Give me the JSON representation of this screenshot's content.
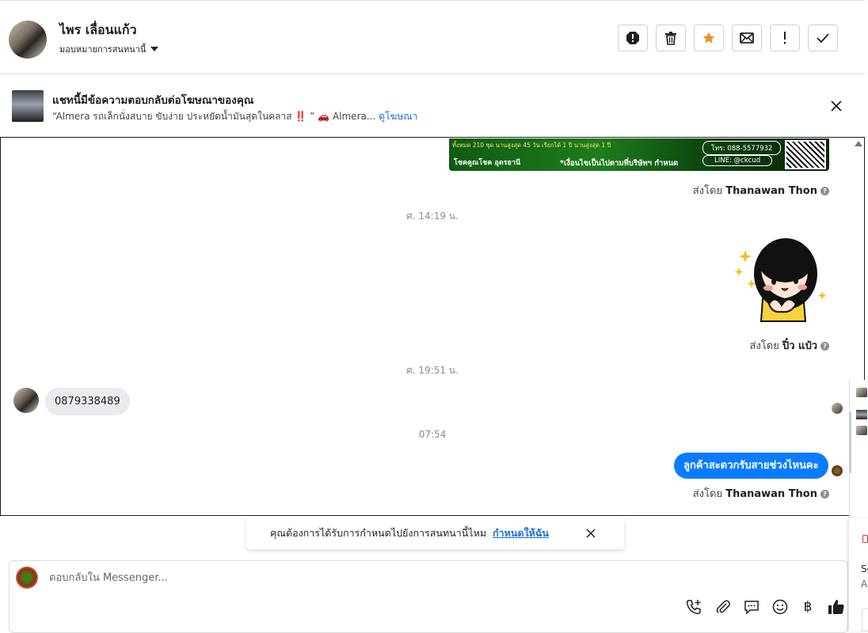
{
  "header": {
    "name": "ไพร เลื่อนแก้ว",
    "assign_label": "มอบหมายการสนทนานี้",
    "actions": [
      "report-icon",
      "trash-icon",
      "star-icon",
      "mail-icon",
      "exclamation-icon",
      "check-icon"
    ]
  },
  "ad": {
    "title": "แชทนี้มีข้อความตอบกลับต่อโฆษณาของคุณ",
    "desc": "“Almera รถเล็กนั่งสบาย ขับง่าย ประหยัดน้ำมันสุดในคลาส ‼️ ” 🚗 Almera...",
    "link": "ดูโฆษณา"
  },
  "banner": {
    "line1": "ทั้งหมด 210 ชุด   นานสูงสุด 45 วัน   เรียกได้ 1 ปี   นานสูงสุด 1 ปี",
    "brand": "โชคคูณโชค อุดรธานี",
    "tagline": "*เงื่อนไขเป็นไปตามที่บริษัทฯ กำหนด",
    "phone": "โทร: 088-5577932",
    "line_id": "LINE: @ckcud"
  },
  "messages": {
    "sent_by_1_prefix": "ส่งโดย",
    "sent_by_1_name": "Thanawan Thon",
    "ts_1": "ศ. 14:19 น.",
    "sent_by_2_prefix": "ส่งโดย",
    "sent_by_2_name": "ปิ๋ว แป๋ว",
    "ts_2": "ศ. 19:51 น.",
    "incoming_1": "0879338489",
    "ts_3": "07:54",
    "outgoing_1": "ลูกค้าสะดวกรับสายช่วงไหนคะ",
    "sent_by_3_prefix": "ส่งโดย",
    "sent_by_3_name": "Thanawan Thon",
    "help_glyph": "?"
  },
  "prompt": {
    "text": "คุณต้องการได้รับการกำหนดไปยังการสนทนานี้ไหม",
    "link": "กำหนดให้ฉัน"
  },
  "composer": {
    "placeholder": "ตอบกลับใน Messenger...",
    "tools": [
      "phone-add-icon",
      "paperclip-icon",
      "chat-bubble-icon",
      "emoji-icon",
      "baht-icon",
      "thumbs-up-icon"
    ],
    "baht_symbol": "฿"
  },
  "edge": {
    "text1": "Sc",
    "text2": "A"
  },
  "colors": {
    "accent": "#0a7cff",
    "star": "#f28c28",
    "link": "#1a6ed8"
  }
}
